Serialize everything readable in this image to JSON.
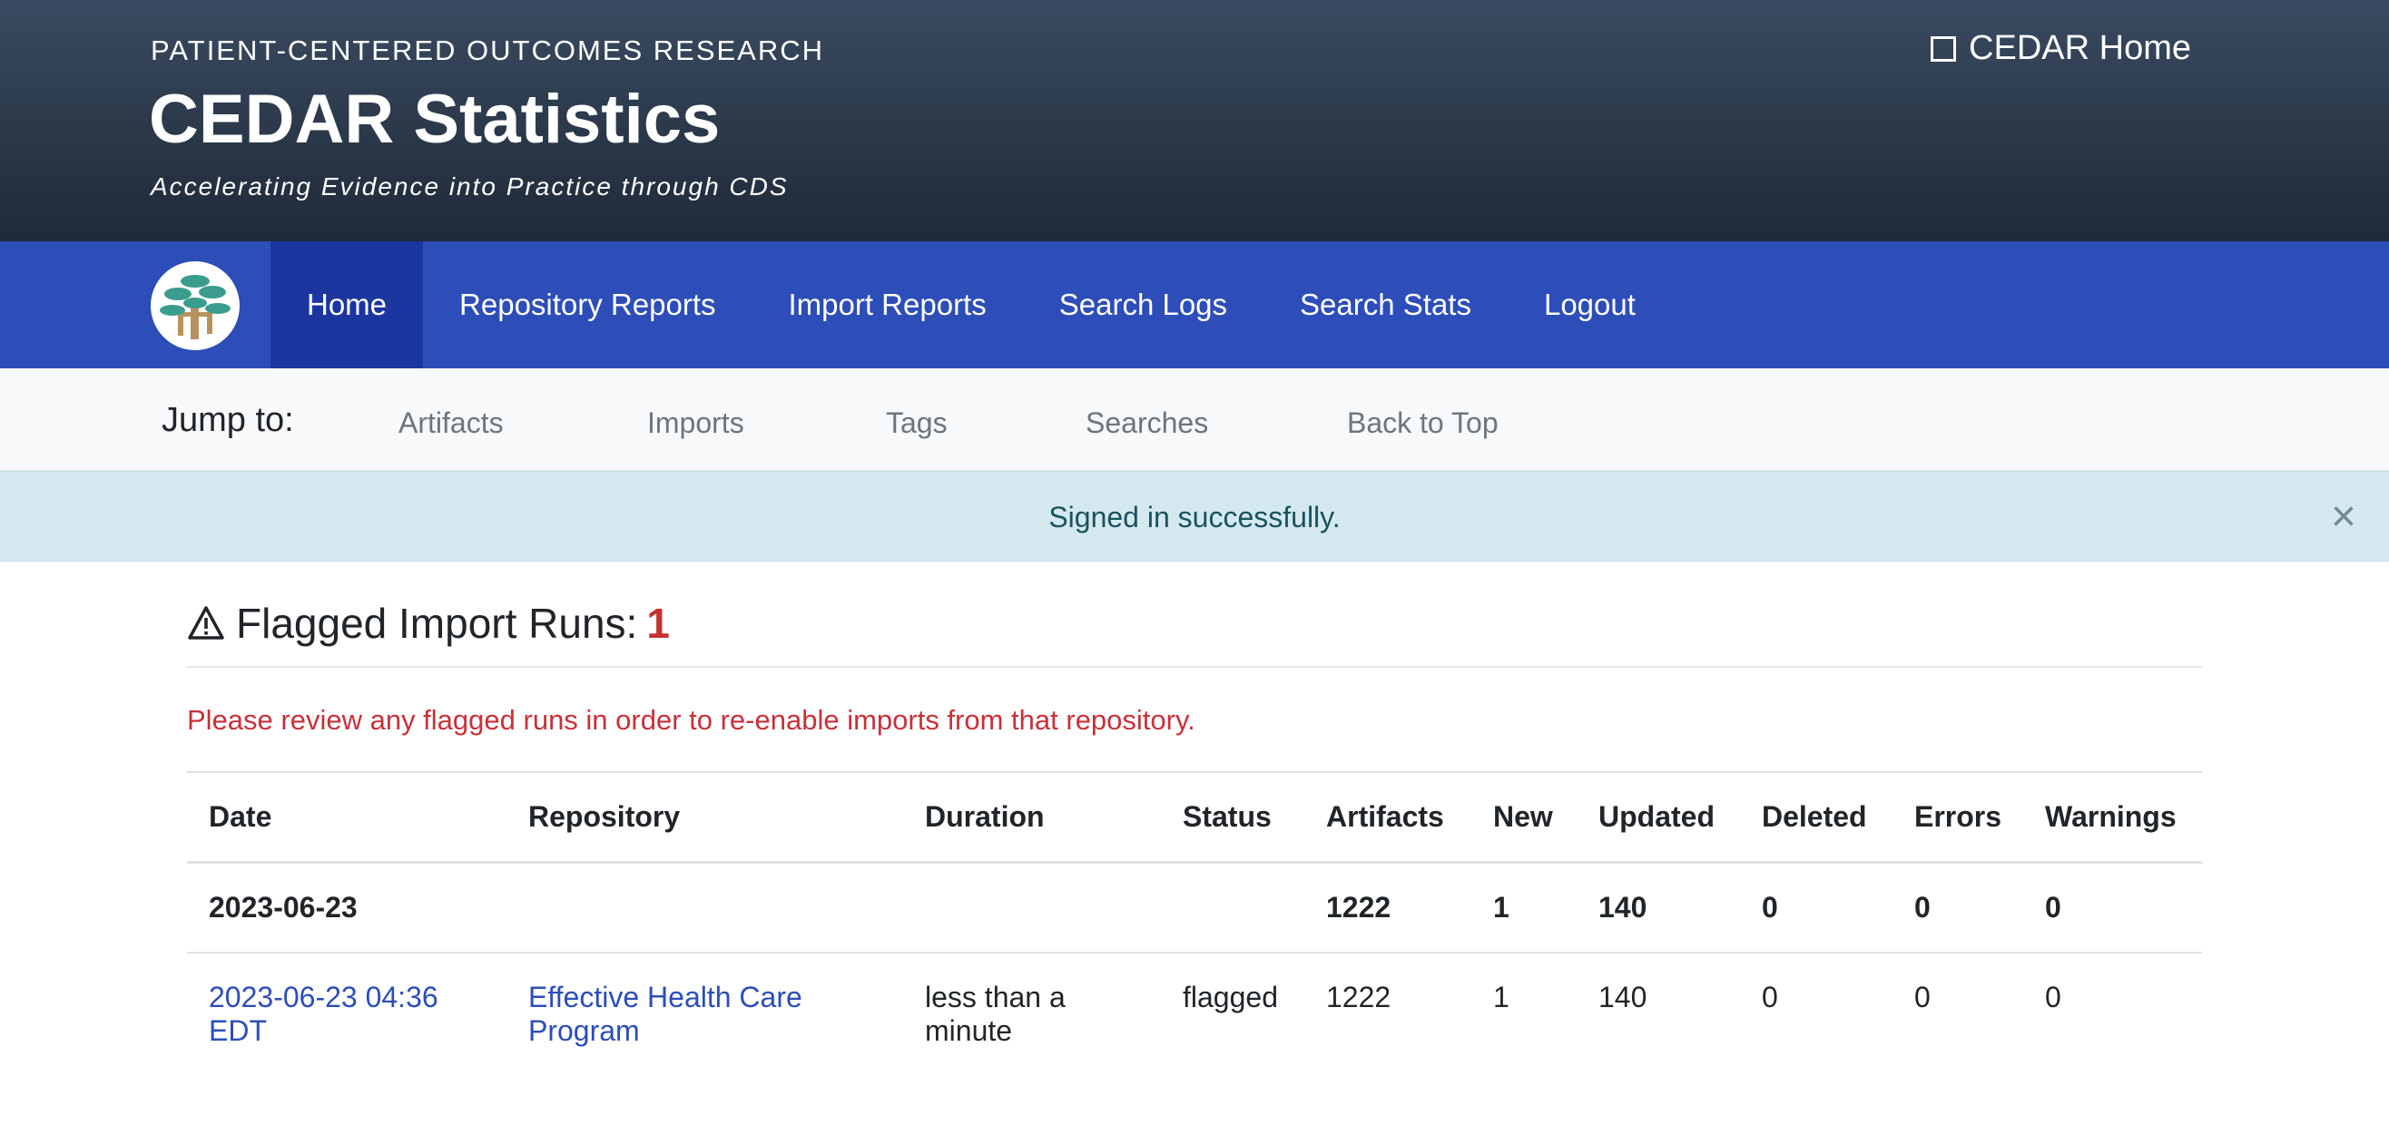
{
  "header": {
    "org": "PATIENT-CENTERED OUTCOMES RESEARCH",
    "title": "CEDAR Statistics",
    "tagline": "Accelerating Evidence into Practice through CDS",
    "home_link": "CEDAR Home"
  },
  "nav": {
    "items": [
      {
        "label": "Home",
        "active": true
      },
      {
        "label": "Repository Reports"
      },
      {
        "label": "Import Reports"
      },
      {
        "label": "Search Logs"
      },
      {
        "label": "Search Stats"
      },
      {
        "label": "Logout"
      }
    ]
  },
  "jump": {
    "label": "Jump to:",
    "links": [
      "Artifacts",
      "Imports",
      "Tags",
      "Searches",
      "Back to Top"
    ]
  },
  "alert": {
    "message": "Signed in successfully.",
    "close": "×"
  },
  "flagged": {
    "title": "Flagged Import Runs:",
    "count": "1",
    "notice": "Please review any flagged runs in order to re-enable imports from that repository."
  },
  "table": {
    "headers": [
      "Date",
      "Repository",
      "Duration",
      "Status",
      "Artifacts",
      "New",
      "Updated",
      "Deleted",
      "Errors",
      "Warnings"
    ],
    "group_row": [
      "2023-06-23",
      "",
      "",
      "",
      "1222",
      "1",
      "140",
      "0",
      "0",
      "0"
    ],
    "rows": [
      [
        "2023-06-23 04:36 EDT",
        "Effective Health Care Program",
        "less than a minute",
        "flagged",
        "1222",
        "1",
        "140",
        "0",
        "0",
        "0"
      ]
    ]
  },
  "colors": {
    "header_bg": "#2a3648",
    "nav_bg": "#2d4db8",
    "nav_active": "#1c36a0",
    "alert_bg": "#d4e9ef",
    "danger": "#c8313a",
    "link": "#2d4db8"
  },
  "icons": {
    "home": "square-icon",
    "flagged": "warning-triangle-icon",
    "logo": "cedar-tree-logo"
  }
}
